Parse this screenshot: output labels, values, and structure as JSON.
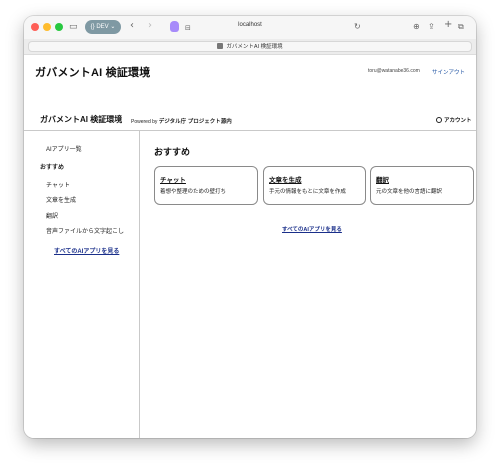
{
  "browser": {
    "dev_label": "{} DEV ⌄",
    "url": "localhost",
    "tab_title": "ガバメントAI 検証環境"
  },
  "header": {
    "site_title": "ガバメントAI 検証環境",
    "email": "toru@watanabe36.com",
    "signout": "サインアウト"
  },
  "subheader": {
    "title": "ガバメントAI 検証環境",
    "powered_prefix": "Powered by",
    "powered_by": "デジタル庁 プロジェクト源内",
    "account": "アカウント"
  },
  "sidebar": {
    "ai_list": "AIアプリ一覧",
    "recommended": "おすすめ",
    "items": [
      "チャット",
      "文章を生成",
      "翻訳",
      "音声ファイルから文字起こし"
    ],
    "all_link": "すべてのAIアプリを見る"
  },
  "main": {
    "title": "おすすめ",
    "cards": [
      {
        "title": "チャット",
        "desc": "着想や整理のための壁打ち"
      },
      {
        "title": "文章を生成",
        "desc": "手元の情報をもとに文章を作成"
      },
      {
        "title": "翻訳",
        "desc": "元の文章を他の言語に翻訳"
      }
    ],
    "all_link": "すべてのAIアプリを見る"
  }
}
